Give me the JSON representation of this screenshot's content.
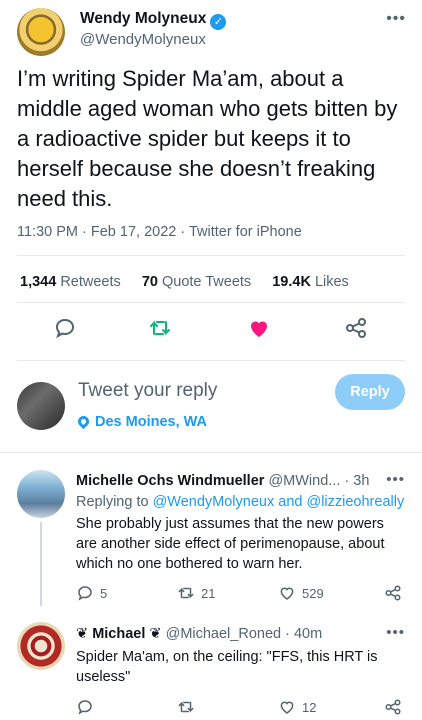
{
  "tweet": {
    "author_name": "Wendy Molyneux",
    "author_handle": "@WendyMolyneux",
    "text": "I’m writing Spider Ma’am, about a middle aged woman who gets bitten by a radioactive spider but keeps it to herself because she doesn’t freaking need this.",
    "meta": "11:30 PM · Feb 17, 2022 · Twitter for iPhone",
    "stats": {
      "retweets_count": "1,344",
      "retweets_label": "Retweets",
      "quotes_count": "70",
      "quotes_label": "Quote Tweets",
      "likes_count": "19.4K",
      "likes_label": "Likes"
    }
  },
  "compose": {
    "placeholder": "Tweet your reply",
    "reply_button": "Reply",
    "location": "Des Moines, WA"
  },
  "replies": [
    {
      "name": "Michelle Ochs Windmueller",
      "handle": "@MWind...",
      "time": "· 3h",
      "replying_prefix": "Replying to",
      "replying_to": "@WendyMolyneux and @lizzieohreally",
      "text": "She probably just assumes that the new powers are another side effect of perimenopause, about which no one bothered to warn her.",
      "reply_count": "5",
      "retweet_count": "21",
      "like_count": "529"
    },
    {
      "name": "Michael",
      "handle": "@Michael_Roned",
      "time": "· 40m",
      "text": "Spider Ma'am, on the ceiling: \"FFS, this HRT is useless\"",
      "like_count": "12"
    }
  ],
  "colors": {
    "accent": "#1d9bf0",
    "like_pink": "#f91880",
    "retweet_green": "#00ba7c"
  }
}
